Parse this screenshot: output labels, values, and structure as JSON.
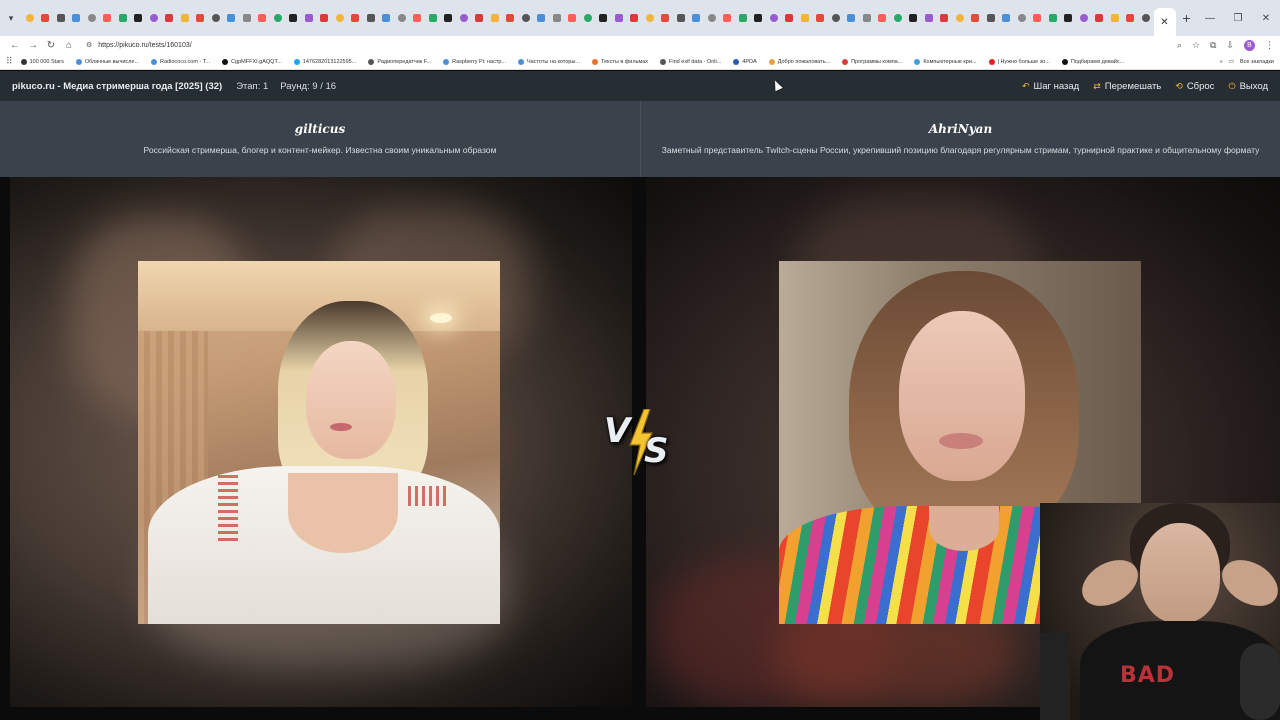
{
  "browser": {
    "active_tab_close": "✕",
    "new_tab": "+",
    "url": "https://pikuco.ru/tests/160103/",
    "bookmarks": [
      {
        "label": "100 000 Stars",
        "color": "#333333"
      },
      {
        "label": "Облачные вычисле...",
        "color": "#4a90d9"
      },
      {
        "label": "Radiococo.com - T...",
        "color": "#4a90d9"
      },
      {
        "label": "CgpMFFXI.gAQQT...",
        "color": "#111111"
      },
      {
        "label": "1476282013122595...",
        "color": "#1da1f2"
      },
      {
        "label": "Радиопередатчик F...",
        "color": "#555555"
      },
      {
        "label": "Raspberry Pi: настр...",
        "color": "#4a90d9"
      },
      {
        "label": "Частоты на которы...",
        "color": "#4a90d9"
      },
      {
        "label": "Тексты в фильмах",
        "color": "#e8712c"
      },
      {
        "label": "Find exif data - Onli...",
        "color": "#555555"
      },
      {
        "label": "4PDA",
        "color": "#2a5caa"
      },
      {
        "label": "Добро пожаловать...",
        "color": "#e8a23c"
      },
      {
        "label": "Программы компа...",
        "color": "#d93b3b"
      },
      {
        "label": "Компьютерные кри...",
        "color": "#3aa0d9"
      },
      {
        "label": "| Нужно больше зо...",
        "color": "#e22222"
      },
      {
        "label": "Подбираем девайс...",
        "color": "#111111"
      }
    ],
    "all_bookmarks": "Все закладки",
    "avatar_letter": "B"
  },
  "header": {
    "title": "pikuco.ru - Медиа стримерша года [2025] (32)",
    "stage": "Этап: 1",
    "round": "Раунд: 9 / 16",
    "actions": {
      "back": "Шаг назад",
      "shuffle": "Перемешать",
      "reset": "Сброс",
      "exit": "Выход"
    }
  },
  "candidates": {
    "left": {
      "name": "gilticus",
      "description": "Российская стримерша, блогер и контент-мейкер. Известна своим уникальным образом"
    },
    "right": {
      "name": "AhriNyan",
      "description": "Заметный представитель Twitch-сцены России, укрепивший позицию благодаря регулярным стримам, турнирной практике и общительному формату"
    }
  },
  "vs": {
    "v": "V",
    "s": "S"
  },
  "colors": {
    "header_bg": "#262d33",
    "desc_bg": "#3a434b",
    "accent": "#f2b53a",
    "bolt": "#f5c531"
  }
}
